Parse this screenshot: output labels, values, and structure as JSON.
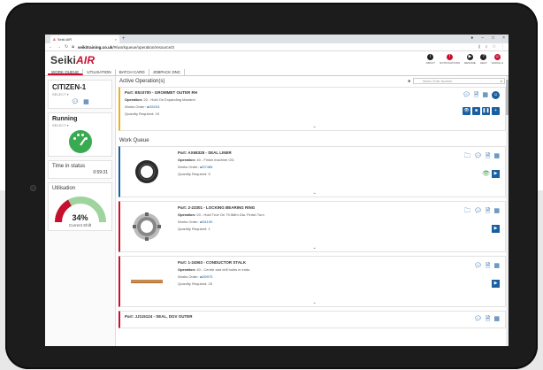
{
  "browser": {
    "tab_title": "Seiki AIR",
    "tab_close": "×",
    "new_tab": "+",
    "url_host": "seikitraining.co.uk",
    "url_path": "/#/workqueue/operation/resource/3"
  },
  "app": {
    "logo_text": "Seiki",
    "logo_accent": "AIR",
    "accent_color": "#c8102e",
    "primary_color": "#1a5fa0",
    "tools": [
      {
        "label": "ABOUT",
        "icon": "info-icon"
      },
      {
        "label": "NOTIFICATIONS",
        "icon": "bell-icon"
      },
      {
        "label": "RESUME",
        "icon": "play-icon"
      },
      {
        "label": "HELP",
        "icon": "help-icon"
      },
      {
        "label": "SARAH H",
        "icon": "user-icon"
      }
    ],
    "menu": [
      "WORK QUEUE",
      "UTILISATION",
      "BATCH CARD",
      "JOBPACK DNC"
    ]
  },
  "sidebar": {
    "machine_name": "CITIZEN-1",
    "machine_select": "SELECT ▾",
    "status": "Running",
    "status_select": "SELECT ▾",
    "time_label": "Time in status",
    "time_value": "0:59:31",
    "util_label": "Utilisation",
    "util_pct": "34%",
    "util_value": 0.34,
    "util_sub": "Current Shift"
  },
  "main": {
    "active_title": "Active Operation(s)",
    "search_placeholder": "Works Order Number",
    "active_op": {
      "part": "Part: B510700 - GROMMET OUTER RH",
      "operation_label": "Operation:",
      "operation_value": "20 - Hold On Expanding Mandrel.",
      "wo_label": "Works Order:",
      "wo_value": "33203",
      "qty_label": "Quantity Required:",
      "qty_value": "15"
    },
    "queue_title": "Work Queue",
    "jobs": [
      {
        "part": "Part: AX68328 - SEAL LINER",
        "operation_label": "Operation:",
        "operation_value": "40 - Finish machine OD.",
        "wo_label": "Works Order:",
        "wo_value": "37486",
        "qty_label": "Quantity Required:",
        "qty_value": "5"
      },
      {
        "part": "Part: 2-23301 - LOCKING BEARING RING",
        "operation_label": "Operation:",
        "operation_value": "20 - Hold True On 79.5Mm Dia. Finish Turn",
        "wo_label": "Works Order:",
        "wo_value": "34190",
        "qty_label": "Quantity Required:",
        "qty_value": "1"
      },
      {
        "part": "Part: 1-24063 - CONDUCTOR STALK",
        "operation_label": "Operation:",
        "operation_value": "40 - Centre and drill holes in ends.",
        "wo_label": "Works Order:",
        "wo_value": "39970",
        "qty_label": "Quantity Required:",
        "qty_value": "25"
      }
    ],
    "last_job_part": "Part: JJ115124 - SEAL, DGV OUTER"
  }
}
